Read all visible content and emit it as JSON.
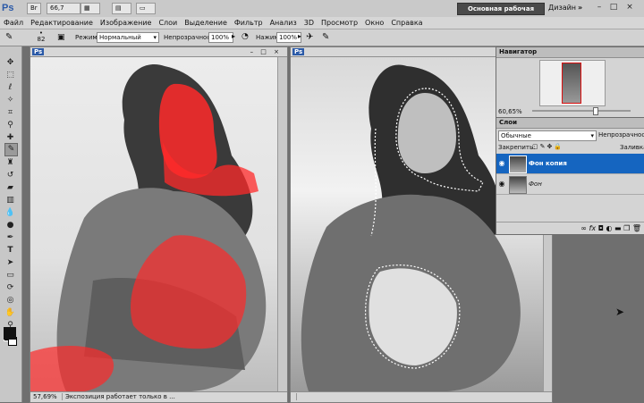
{
  "app": {
    "logo": "Ps",
    "zoom_chip": "66,7",
    "workspace_active": "Основная рабочая среда",
    "workspace_other": "Дизайн",
    "more": "»",
    "window_controls": [
      "–",
      "□",
      "×"
    ]
  },
  "menu": [
    "Файл",
    "Редактирование",
    "Изображение",
    "Слои",
    "Выделение",
    "Фильтр",
    "Анализ",
    "3D",
    "Просмотр",
    "Окно",
    "Справка"
  ],
  "options": {
    "brush_size": "82",
    "mode_label": "Режим:",
    "mode_value": "Нормальный",
    "opacity_label": "Непрозрачность:",
    "opacity_value": "100%",
    "pressure_label": "Нажим:",
    "pressure_value": "100%"
  },
  "tools": [
    "move-tool",
    "marquee-tool",
    "lasso-tool",
    "quick-select-tool",
    "crop-tool",
    "eyedropper-tool",
    "healing-tool",
    "brush-tool",
    "stamp-tool",
    "history-brush-tool",
    "eraser-tool",
    "gradient-tool",
    "blur-tool",
    "dodge-tool",
    "pen-tool",
    "type-tool",
    "path-select-tool",
    "shape-tool",
    "3d-rotate-tool",
    "3d-orbit-tool",
    "hand-tool",
    "zoom-tool"
  ],
  "doc_left": {
    "zoom": "57,69%",
    "status": "Экспозиция работает только в ..."
  },
  "doc_right": {
    "zoom": "",
    "status": ""
  },
  "navigator": {
    "title": "Навигатор",
    "zoom": "60,65%"
  },
  "layers": {
    "title": "Слои",
    "blend_mode": "Обычные",
    "opacity_label": "Непрозрачность:",
    "lock_label": "Закрепить:",
    "fill_label": "Заливка:",
    "items": [
      {
        "name": "Фон копия",
        "selected": true
      },
      {
        "name": "Фон",
        "selected": false
      }
    ],
    "footer_icons": [
      "link-icon",
      "fx-icon",
      "mask-icon",
      "adjustment-icon",
      "folder-icon",
      "new-layer-icon",
      "trash-icon"
    ]
  },
  "colors": {
    "selection": "#1565c0",
    "mask_overlay": "#ff2a2a",
    "workspace_button": "#4a4a4a"
  }
}
